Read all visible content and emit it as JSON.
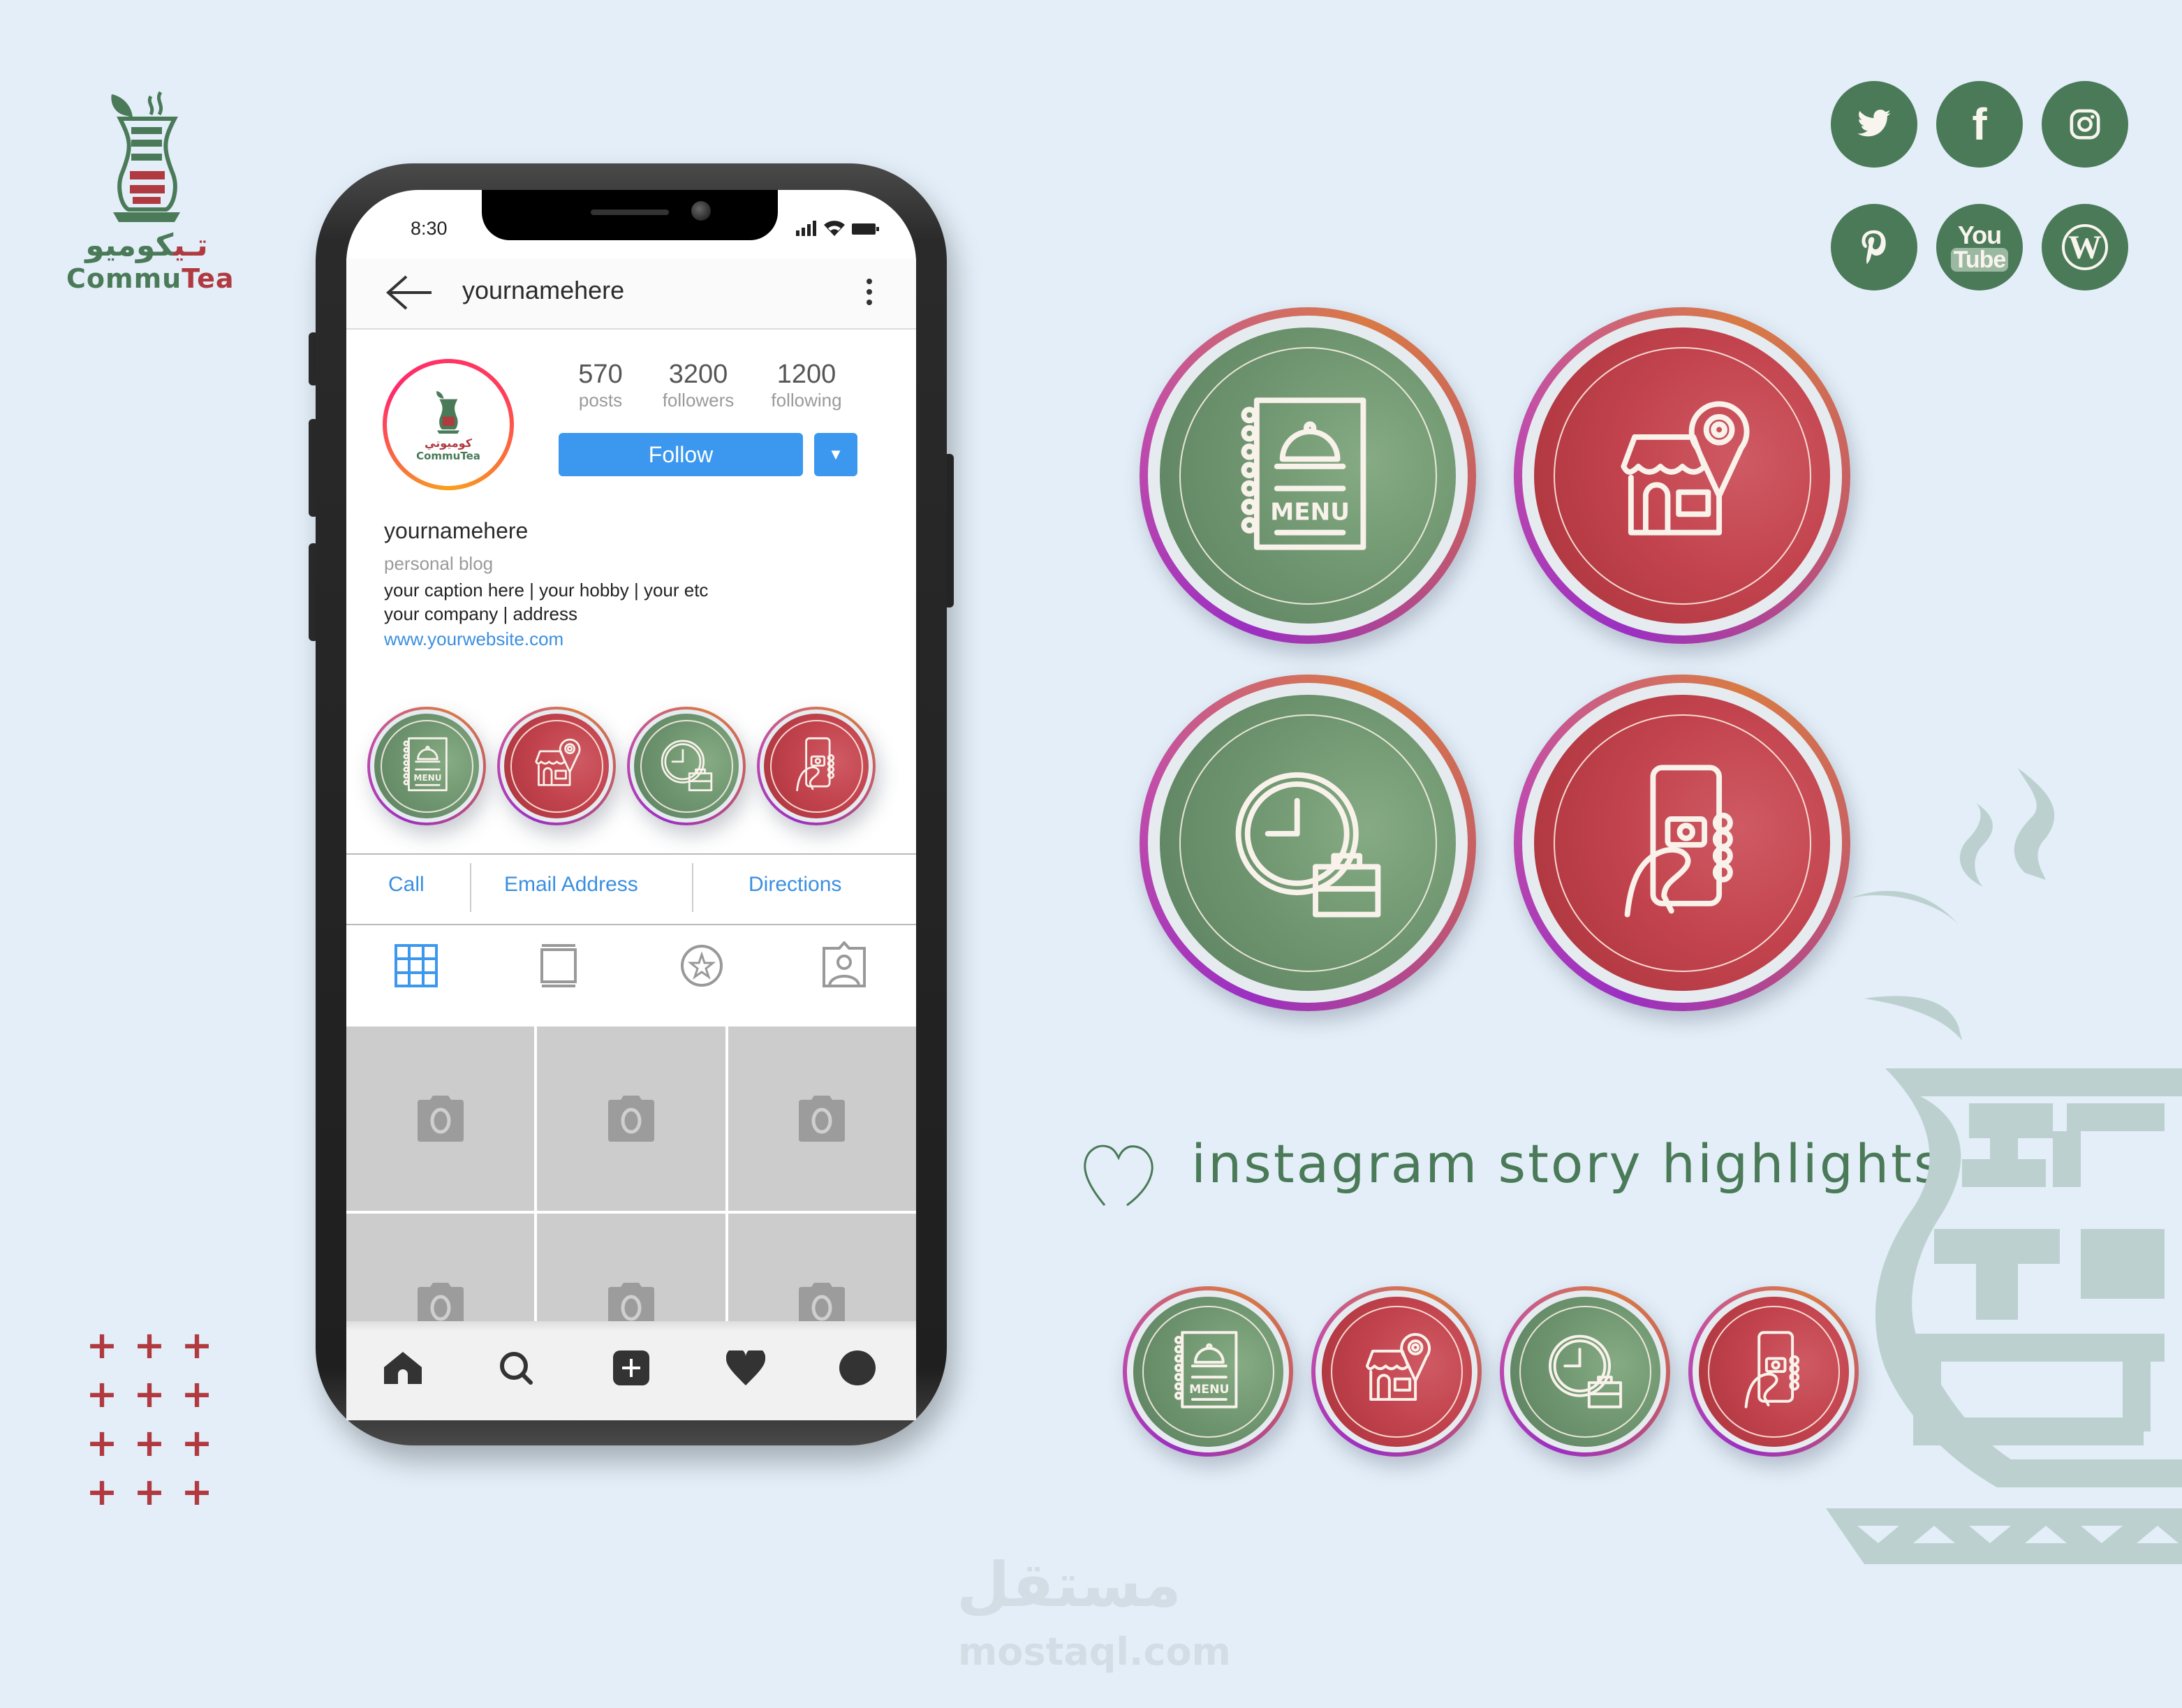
{
  "brand": {
    "name_ar_main": "كوميو",
    "name_ar_accent": "تـي",
    "name_en_main": "Commu",
    "name_en_accent": "Tea",
    "colors": {
      "green": "#4a7a58",
      "red": "#b03a40",
      "background": "#e3eef8"
    }
  },
  "social": [
    {
      "name": "twitter",
      "icon": "twitter-icon"
    },
    {
      "name": "facebook",
      "icon": "facebook-icon",
      "glyph": "f"
    },
    {
      "name": "instagram",
      "icon": "instagram-icon"
    },
    {
      "name": "pinterest",
      "icon": "pinterest-icon",
      "glyph": "P"
    },
    {
      "name": "youtube",
      "icon": "youtube-icon",
      "top": "You",
      "bottom": "Tube"
    },
    {
      "name": "wordpress",
      "icon": "wordpress-icon",
      "glyph": "W"
    }
  ],
  "phone": {
    "status": {
      "time": "8:30"
    },
    "header": {
      "username": "yournamehere",
      "back_icon": "arrow-left-icon",
      "more_icon": "more-vertical-icon"
    },
    "profile": {
      "avatar_brand_ar": "كوميوتي",
      "avatar_brand_en": "CommuTea",
      "stats": [
        {
          "value": "570",
          "label": "posts"
        },
        {
          "value": "3200",
          "label": "followers"
        },
        {
          "value": "1200",
          "label": "following"
        }
      ],
      "follow_label": "Follow",
      "follow_dropdown": "▼"
    },
    "bio": {
      "name": "yournamehere",
      "category": "personal blog",
      "line1": "your caption here  | your hobby | your etc",
      "line2": "your company | address",
      "website": "www.yourwebsite.com"
    },
    "highlights": [
      {
        "icon": "menu-book-icon",
        "color": "green",
        "text": "MENU"
      },
      {
        "icon": "store-location-icon",
        "color": "red"
      },
      {
        "icon": "clock-briefcase-icon",
        "color": "green"
      },
      {
        "icon": "phone-camera-icon",
        "color": "red"
      }
    ],
    "actions": [
      "Call",
      "Email Address",
      "Directions"
    ],
    "tabs": [
      {
        "icon": "grid-icon",
        "active": true
      },
      {
        "icon": "feed-icon",
        "active": false
      },
      {
        "icon": "star-icon",
        "active": false
      },
      {
        "icon": "tagged-user-icon",
        "active": false
      }
    ],
    "post_count_visible": 6,
    "bottom_nav": [
      "home-icon",
      "search-icon",
      "add-post-icon",
      "heart-icon",
      "profile-icon"
    ],
    "accent_blue": "#3b98ee"
  },
  "showcase": {
    "large_highlights": [
      {
        "icon": "menu-book-icon",
        "color": "green",
        "text": "MENU"
      },
      {
        "icon": "store-location-icon",
        "color": "red"
      },
      {
        "icon": "clock-briefcase-icon",
        "color": "green"
      },
      {
        "icon": "phone-camera-icon",
        "color": "red"
      }
    ],
    "tagline": "instagram story highlights",
    "tagline_icon": "heart-outline-icon",
    "small_highlights": [
      {
        "icon": "menu-book-icon",
        "color": "green",
        "text": "MENU"
      },
      {
        "icon": "store-location-icon",
        "color": "red"
      },
      {
        "icon": "clock-briefcase-icon",
        "color": "green"
      },
      {
        "icon": "phone-camera-icon",
        "color": "red"
      }
    ]
  },
  "decor": {
    "plus_glyph": "+",
    "plus_rows": 4,
    "plus_cols": 3
  },
  "watermark": {
    "ar": "مستقل",
    "en": "mostaql.com"
  }
}
